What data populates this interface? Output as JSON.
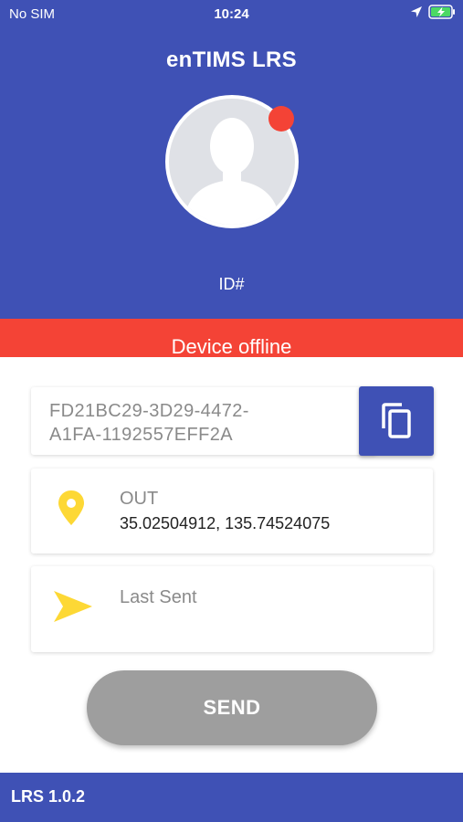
{
  "status_bar": {
    "carrier": "No SIM",
    "time": "10:24",
    "icons": [
      "location-arrow-icon",
      "battery-charging-icon"
    ]
  },
  "header": {
    "title": "enTIMS LRS",
    "avatar_icon": "user-silhouette-icon",
    "id_label": "ID#"
  },
  "banner": {
    "text": "Device offline"
  },
  "device": {
    "id_line1": "FD21BC29-3D29-4472-",
    "id_line2": "A1FA-1192557EFF2A",
    "copy_icon": "copy-icon"
  },
  "location": {
    "icon": "map-pin-icon",
    "status": "OUT",
    "coordinates": "35.02504912, 135.74524075"
  },
  "last_sent": {
    "icon": "send-icon",
    "label": "Last Sent"
  },
  "actions": {
    "send_label": "SEND"
  },
  "footer": {
    "version": "LRS 1.0.2"
  },
  "colors": {
    "primary": "#3f51b5",
    "offline_red": "#f44336",
    "pin_yellow": "#fdd835",
    "disabled_gray": "#9e9e9e",
    "battery_green": "#4cd964"
  }
}
